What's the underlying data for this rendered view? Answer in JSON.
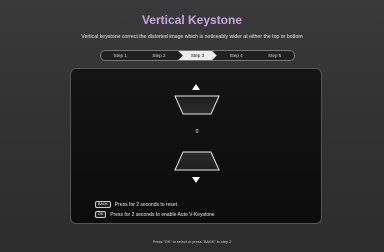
{
  "header": {
    "title": "Vertical Keystone",
    "subtitle": "Vertical keystone correct the distorted image which is noticeably wider at either the top or bottom"
  },
  "steps": [
    "Step 1",
    "Step 2",
    "Step 3",
    "Step 4",
    "Step 5"
  ],
  "active_step": "Step 3",
  "panel": {
    "value": "0",
    "hints": [
      {
        "key": "BACK",
        "text": "Press for 2 seconds to reset"
      },
      {
        "key": "OK",
        "text": "Press for 2 seconds to enable Auto V-Keystone"
      }
    ]
  },
  "footer": "Press \"OK\" to select or press \"BACK\" to step 2",
  "colors": {
    "title": "#c7a6e6",
    "accent": "#eeeeee"
  }
}
